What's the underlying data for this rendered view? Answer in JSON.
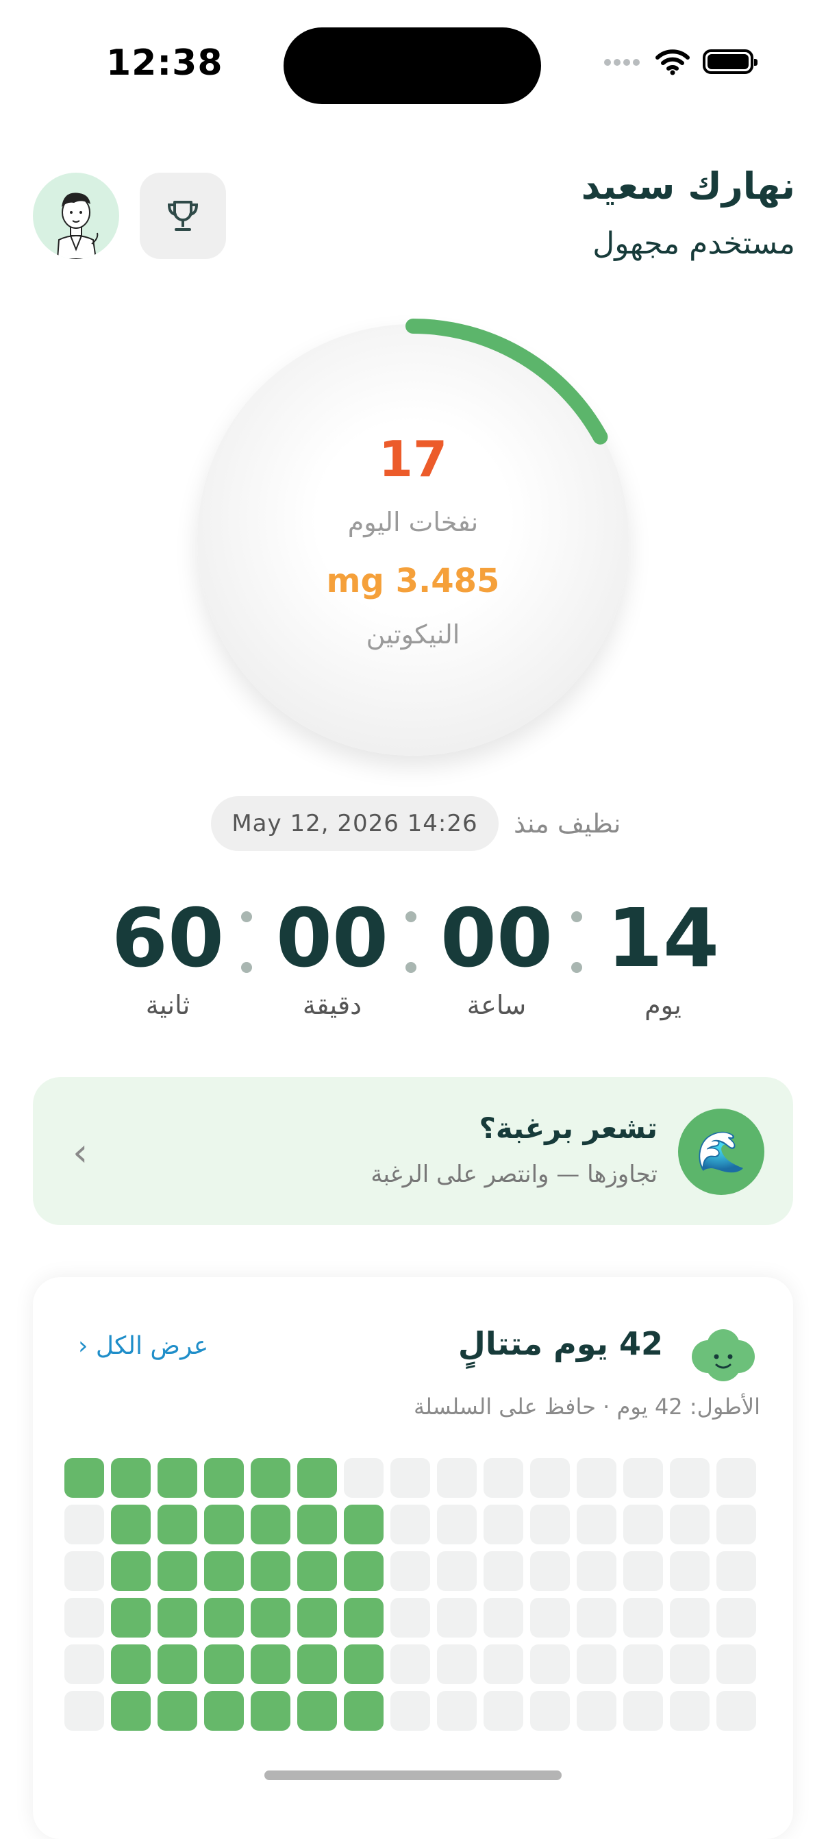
{
  "status_bar": {
    "time": "12:38"
  },
  "header": {
    "greeting": "نهارك سعيد",
    "user_label": "مستخدم مجهول"
  },
  "ring": {
    "puffs_count": "17",
    "puffs_label": "نفخات اليوم",
    "nicotine_value": "mg 3.485",
    "nicotine_label": "النيكوتين",
    "progress": 0.17,
    "progress_color": "#5cb56b"
  },
  "clean_since": {
    "label": "نظيف منذ",
    "date": "May 12, 2026 14:26"
  },
  "timer": {
    "days": "14",
    "days_label": "يوم",
    "hours": "00",
    "hours_label": "ساعة",
    "minutes": "00",
    "minutes_label": "دقيقة",
    "seconds": "60",
    "seconds_label": "ثانية"
  },
  "craving": {
    "title": "تشعر برغبة؟",
    "subtitle": "تجاوزها — وانتصر على الرغبة",
    "icon": "wave-icon"
  },
  "streak": {
    "title": "42 يوم متتالٍ",
    "subtitle": "الأطول: 42 يوم · حافظ على السلسلة",
    "view_all": "عرض الكل",
    "grid": {
      "columns": 15,
      "rows": [
        [
          1,
          1,
          1,
          1,
          1,
          1,
          0,
          0,
          0,
          0,
          0,
          0,
          0,
          0,
          0
        ],
        [
          0,
          1,
          1,
          1,
          1,
          1,
          1,
          0,
          0,
          0,
          0,
          0,
          0,
          0,
          0
        ],
        [
          0,
          1,
          1,
          1,
          1,
          1,
          1,
          0,
          0,
          0,
          0,
          0,
          0,
          0,
          0
        ],
        [
          0,
          1,
          1,
          1,
          1,
          1,
          1,
          0,
          0,
          0,
          0,
          0,
          0,
          0,
          0
        ],
        [
          0,
          1,
          1,
          1,
          1,
          1,
          1,
          0,
          0,
          0,
          0,
          0,
          0,
          0,
          0
        ],
        [
          0,
          1,
          1,
          1,
          1,
          1,
          1,
          0,
          0,
          0,
          0,
          0,
          0,
          0,
          0
        ]
      ],
      "active_color": "#66b86a",
      "inactive_color": "#f0f1f1"
    }
  }
}
